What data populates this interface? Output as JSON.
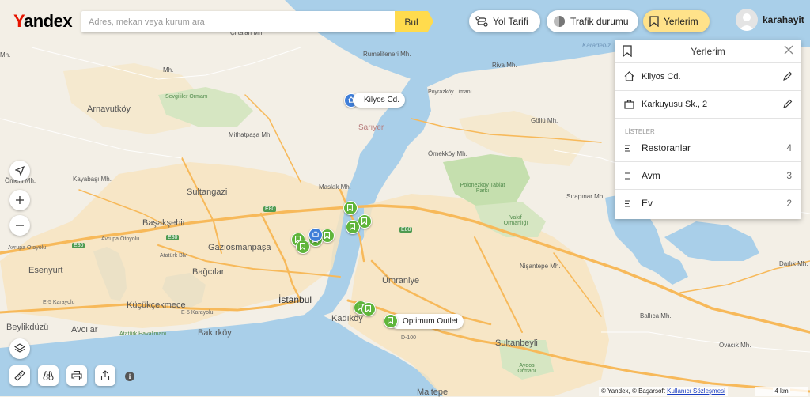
{
  "header": {
    "logo_y": "Y",
    "logo_rest": "andex",
    "search_placeholder": "Adres, mekan veya kurum ara",
    "search_button": "Bul",
    "route_label": "Yol Tarifi",
    "traffic_label": "Trafik durumu",
    "places_label": "Yerlerim",
    "username": "karahayit"
  },
  "panel": {
    "title": "Yerlerim",
    "addresses": [
      {
        "icon": "home-icon",
        "label": "Kilyos Cd."
      },
      {
        "icon": "briefcase-icon",
        "label": "Karkuyusu Sk., 2"
      }
    ],
    "lists_heading": "LİSTELER",
    "lists": [
      {
        "name": "Restoranlar",
        "count": "4"
      },
      {
        "name": "Avm",
        "count": "3"
      },
      {
        "name": "Ev",
        "count": "2"
      }
    ]
  },
  "map": {
    "markers": {
      "home_label": "Kilyos Cd.",
      "outlet_label": "Optimum Outlet"
    },
    "labels": {
      "istanbul": "İstanbul",
      "sariyer": "Sarıyer",
      "arnavutkoy": "Arnavutköy",
      "sultangazi": "Sultangazi",
      "basaksehir": "Başakşehir",
      "gaziosmanpasa": "Gaziosmanpaşa",
      "esenyurt": "Esenyurt",
      "bagcilar": "Bağcılar",
      "kucukcekmece": "Küçükçekmece",
      "beylikduzu": "Beylikdüzü",
      "avcilar": "Avcılar",
      "bakirkoy": "Bakırköy",
      "umraniye": "Ümraniye",
      "kadikoy": "Kadıköy",
      "sultanbeyli": "Sultanbeyli",
      "maltepe": "Maltepe",
      "rumelifeneri": "Rumelifeneri Mh.",
      "riva": "Riva Mh.",
      "ciftalan": "Çiftalan Mh.",
      "mithatpasa": "Mithatpaşa Mh.",
      "kayabasi": "Kayabaşı Mh.",
      "omerli": "Ömerli Mh.",
      "maslak": "Maslak Mh.",
      "golluu": "Göllü Mh.",
      "ornekkoy": "Örnekköy Mh.",
      "sirapinar": "Sırapınar Mh.",
      "nisantepe": "Nişantepe Mh.",
      "darlik": "Darlık Mh.",
      "ballica": "Ballıca Mh.",
      "ovacik": "Ovacık Mh.",
      "poyrazkoy": "Poyrazköy Limanı",
      "sevgililer": "Sevgililer Ormanı",
      "polonezkoy": "Polonezköy Tabiat Parkı",
      "vakif": "Vakıf Ormanlığı",
      "karadeniz": "Karadeniz",
      "ataturk": "Atatürk Havalimanı",
      "aydos": "Aydos Ormanı",
      "mh1": "Mh.",
      "mh2": "Mh.",
      "e80a": "E80",
      "e80b": "E80",
      "e80c": "E80",
      "e80d": "E80",
      "avrupa": "Avrupa Otoyolu",
      "avrupa2": "Avrupa Otoyolu",
      "karayolu": "E-5 Karayolu",
      "karayolu2": "E-5 Karayolu",
      "ataturkblv": "Atatürk Blv.",
      "d100": "D-100"
    }
  },
  "footer": {
    "copyright": "© Yandex, © Başarsoft",
    "terms": "Kullanıcı Sözleşmesi",
    "scale": "4 km"
  },
  "colors": {
    "accent": "#ffdb4d",
    "logo_red": "#e61400",
    "pin_green": "#5fb53b",
    "pin_blue": "#3f7ed8",
    "water": "#a9cfe9",
    "road": "#f7b95a"
  }
}
